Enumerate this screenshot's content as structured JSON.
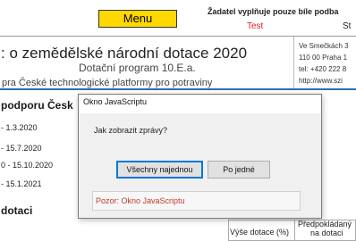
{
  "header": {
    "menu_label": "Menu",
    "notice": "Žadatel vyplňuje pouze bíle podba",
    "test_label": "Test",
    "st_label": "St"
  },
  "form": {
    "title": ": o zemědělské národní dotace 2020",
    "program": "Dotační program 10.E.a.",
    "platform": "pra České technologické platformy pro potraviny",
    "address_lines": [
      "Ve Smečkách 3",
      "110 00 Praha 1",
      "tel: +420 222 8",
      "http://www.szi"
    ],
    "section_support": "podporu Česk",
    "dates": [
      "- 1.3.2020",
      "- 15.7.2020",
      "0 - 15.10.2020",
      "- 15.1.2021"
    ],
    "section_dotaci": "dotaci",
    "table_col1": "Výše dotace (%)",
    "table_col2_line1": "Předpokládaný",
    "table_col2_line2": "na dotaci"
  },
  "dialog": {
    "title": "Okno JavaScriptu",
    "message": "Jak zobrazit zprávy?",
    "button_all": "Všechny najednou",
    "button_one": "Po jedné",
    "warning": "Pozor: Okno JavaScriptu"
  },
  "colors": {
    "menu_bg": "#ffd800",
    "accent_blue": "#2e6fb0",
    "test_red": "#e02020",
    "warning_red": "#c0392b"
  }
}
